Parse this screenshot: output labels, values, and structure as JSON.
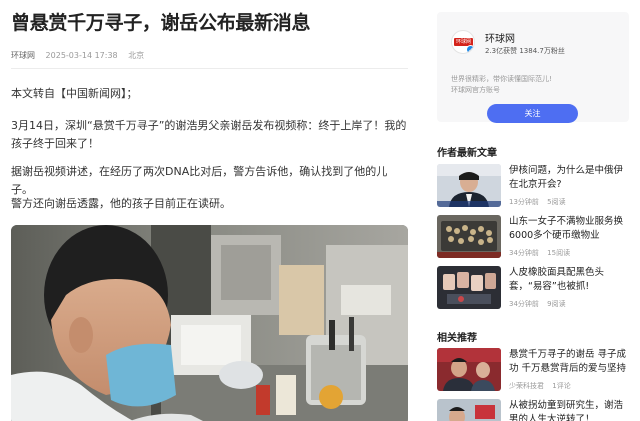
{
  "article": {
    "title": "曾悬赏千万寻子，谢岳公布最新消息",
    "source": "环球网",
    "datetime": "2025-03-14 17:38",
    "location": "北京",
    "paragraphs": [
      "本文转自【中国新闻网】；",
      "3月14日，深圳“悬赏千万寻子”的谢浩男父亲谢岳发布视频称：终于上岸了！我的孩子终于回来了！",
      "据谢岳视频讲述，在经历了两次DNA比对后，警方告诉他，确认找到了他的儿子。",
      "警方还向谢岳透露，他的孩子目前正在读研。"
    ]
  },
  "author": {
    "name": "环球网",
    "avatar_text": "环球网",
    "stats": "2.3亿获赞 1384.7万粉丝",
    "description": "世界很精彩，带你读懂国际范儿!\n环球网官方账号",
    "follow_label": "关注"
  },
  "sidebar": {
    "latest_title": "作者最新文章",
    "latest": [
      {
        "title": "伊核问题，为什么是中俄伊在北京开会?",
        "time": "13分钟前",
        "reads": "5阅读"
      },
      {
        "title": "山东一女子不满物业服务换6000多个硬币缴物业费，...",
        "time": "34分钟前",
        "reads": "15阅读"
      },
      {
        "title": "人皮橡胶面具配黑色头套，“易容”也被抓!",
        "time": "34分钟前",
        "reads": "9阅读"
      }
    ],
    "related_title": "相关推荐",
    "related": [
      {
        "title": "悬赏千万寻子的谢岳 寻子成功 千万悬赏背后的爱与坚持",
        "time": "少荣科技君",
        "reads": "1评论"
      },
      {
        "title": "从被拐幼童到研究生，谢浩男的人生大逆转了！",
        "time": "",
        "reads": ""
      }
    ]
  },
  "colors": {
    "accent": "#4e6ef2",
    "brand_red": "#d4231b"
  }
}
